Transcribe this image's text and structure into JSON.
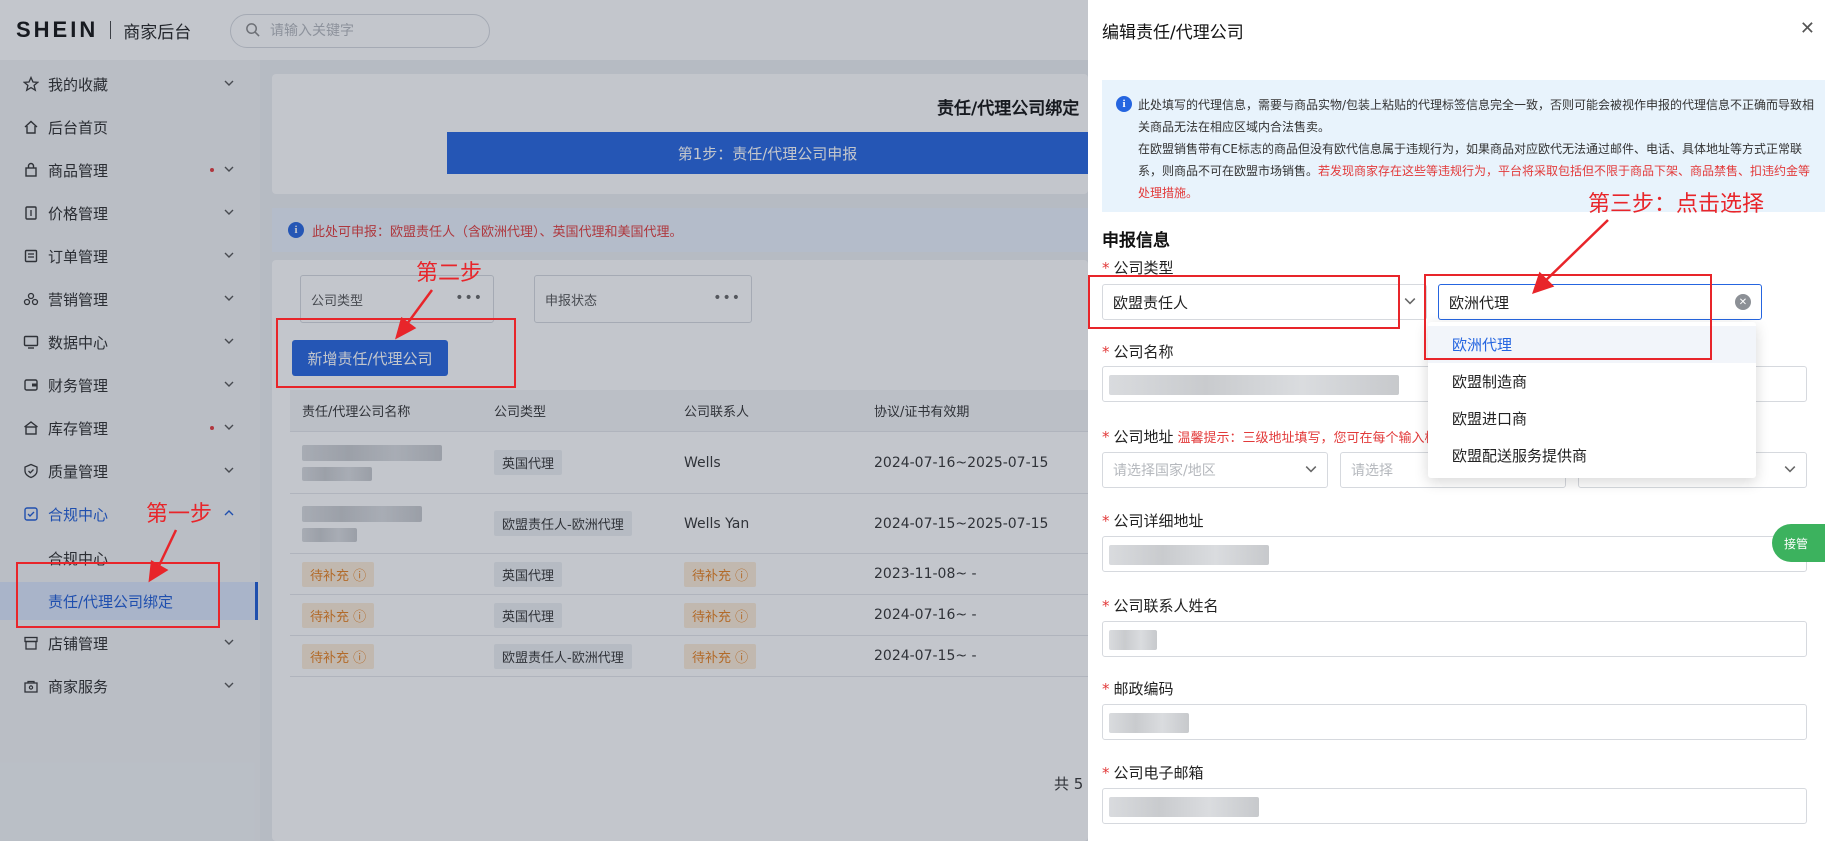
{
  "header": {
    "logo": "SHEIN",
    "subtitle": "商家后台",
    "search_placeholder": "请输入关键字"
  },
  "sidebar": {
    "items": [
      {
        "label": "我的收藏",
        "icon": "star-icon"
      },
      {
        "label": "后台首页",
        "icon": "home-icon"
      },
      {
        "label": "商品管理",
        "icon": "bag-icon"
      },
      {
        "label": "价格管理",
        "icon": "price-tag-icon"
      },
      {
        "label": "订单管理",
        "icon": "order-icon"
      },
      {
        "label": "营销管理",
        "icon": "marketing-icon"
      },
      {
        "label": "数据中心",
        "icon": "monitor-icon"
      },
      {
        "label": "财务管理",
        "icon": "wallet-icon"
      },
      {
        "label": "库存管理",
        "icon": "warehouse-icon"
      },
      {
        "label": "质量管理",
        "icon": "shield-icon"
      },
      {
        "label": "合规中心",
        "icon": "compliance-icon"
      },
      {
        "label": "店铺管理",
        "icon": "store-icon"
      },
      {
        "label": "商家服务",
        "icon": "service-icon"
      }
    ],
    "sub_items": [
      "合规中心",
      "责任/代理公司绑定"
    ]
  },
  "main": {
    "steps_title": "责任/代理公司绑定",
    "step1_label": "第1步：责任/代理公司申报",
    "info_text": "此处可申报：欧盟责任人（含欧洲代理）、英国代理和美国代理。",
    "filters": [
      "公司类型",
      "申报状态"
    ],
    "add_button": "新增责任/代理公司",
    "table": {
      "columns": [
        "责任/代理公司名称",
        "公司类型",
        "公司联系人",
        "协议/证书有效期"
      ],
      "rows": [
        {
          "type": "英国代理",
          "contact": "Wells",
          "validity": "2024-07-16~2025-07-15"
        },
        {
          "type": "欧盟责任人-欧洲代理",
          "contact": "Wells Yan",
          "validity": "2024-07-15~2025-07-15"
        },
        {
          "name": "待补充 ⓘ",
          "type": "英国代理",
          "contact": "待补充 ⓘ",
          "validity": "2023-11-08~ -"
        },
        {
          "name": "待补充 ⓘ",
          "type": "英国代理",
          "contact": "待补充 ⓘ",
          "validity": "2024-07-16~ -"
        },
        {
          "name": "待补充 ⓘ",
          "type": "欧盟责任人-欧洲代理",
          "contact": "待补充 ⓘ",
          "validity": "2024-07-15~ -"
        }
      ]
    },
    "pager_text": "共 5"
  },
  "drawer": {
    "title": "编辑责任/代理公司",
    "notice_line1": "此处填写的代理信息，需要与商品实物/包装上粘贴的代理标签信息完全一致，否则可能会被视作申报的代理信息不正确而导致相关商品无法在相应区域内合法售卖。",
    "notice_line2": "在欧盟销售带有CE标志的商品但没有欧代信息属于违规行为，如果商品对应欧代无法通过邮件、电话、具体地址等方式正常联系，则商品不可在欧盟市场销售。",
    "notice_red": "若发现商家存在这些等违规行为，平台将采取包括但不限于商品下架、商品禁售、扣违约金等处理措施。",
    "section_title": "申报信息",
    "fields": {
      "company_type": {
        "label": "公司类型",
        "value_primary": "欧盟责任人",
        "value_secondary": "欧洲代理"
      },
      "company_name": {
        "label": "公司名称"
      },
      "company_address": {
        "label": "公司地址",
        "hint": "温馨提示：三级地址填写，您可在每个输入框",
        "country_placeholder": "请选择国家/地区",
        "region_placeholder": "请选择"
      },
      "company_detail_address": {
        "label": "公司详细地址"
      },
      "contact_name": {
        "label": "公司联系人姓名"
      },
      "postal_code": {
        "label": "邮政编码"
      },
      "email": {
        "label": "公司电子邮箱"
      }
    },
    "dropdown_options": [
      "欧洲代理",
      "欧盟制造商",
      "欧盟进口商",
      "欧盟配送服务提供商"
    ]
  },
  "float_button": "接管",
  "annotations": {
    "step1": "第一步",
    "step2": "第二步",
    "step3": "第三步：点击选择"
  },
  "colors": {
    "primary": "#2565e0",
    "annotation": "#e8252a",
    "warning": "#e8801e",
    "float": "#3cb25e"
  }
}
